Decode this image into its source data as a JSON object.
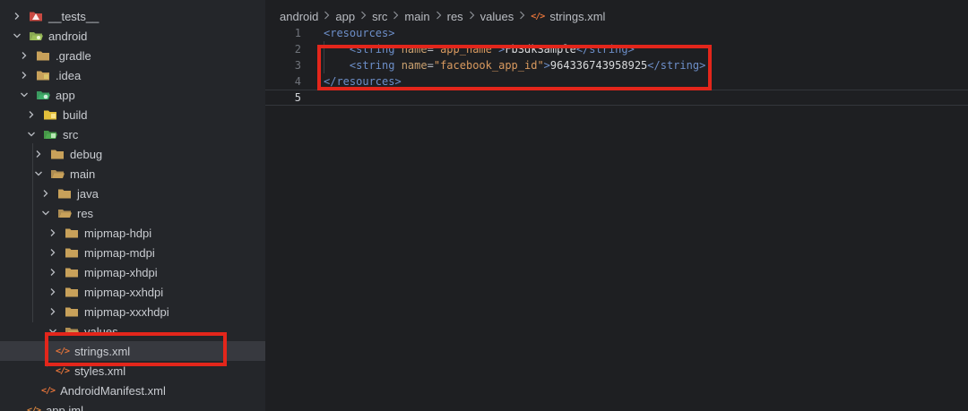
{
  "sidebar": {
    "tree": [
      {
        "label": "__tests__",
        "expanded": false,
        "icon": "tests-folder-icon"
      },
      {
        "label": "android",
        "expanded": true,
        "icon": "android-folder-icon"
      },
      {
        "label": ".gradle",
        "expanded": false,
        "icon": "folder-icon"
      },
      {
        "label": ".idea",
        "expanded": false,
        "icon": "idea-folder-icon"
      },
      {
        "label": "app",
        "expanded": true,
        "icon": "app-folder-icon"
      },
      {
        "label": "build",
        "expanded": false,
        "icon": "build-folder-icon"
      },
      {
        "label": "src",
        "expanded": true,
        "icon": "src-folder-icon"
      },
      {
        "label": "debug",
        "expanded": false,
        "icon": "folder-icon"
      },
      {
        "label": "main",
        "expanded": true,
        "icon": "folder-open-icon"
      },
      {
        "label": "java",
        "expanded": false,
        "icon": "folder-icon"
      },
      {
        "label": "res",
        "expanded": true,
        "icon": "folder-open-icon"
      },
      {
        "label": "mipmap-hdpi",
        "expanded": false,
        "icon": "folder-icon"
      },
      {
        "label": "mipmap-mdpi",
        "expanded": false,
        "icon": "folder-icon"
      },
      {
        "label": "mipmap-xhdpi",
        "expanded": false,
        "icon": "folder-icon"
      },
      {
        "label": "mipmap-xxhdpi",
        "expanded": false,
        "icon": "folder-icon"
      },
      {
        "label": "mipmap-xxxhdpi",
        "expanded": false,
        "icon": "folder-icon"
      },
      {
        "label": "values",
        "expanded": true,
        "icon": "folder-open-icon"
      },
      {
        "label": "strings.xml",
        "selected": true,
        "icon": "xml-file-icon"
      },
      {
        "label": "styles.xml",
        "icon": "xml-file-icon"
      },
      {
        "label": "AndroidManifest.xml",
        "icon": "xml-file-icon"
      },
      {
        "label": "app.iml",
        "icon": "iml-file-icon"
      }
    ]
  },
  "editor": {
    "breadcrumb": [
      "android",
      "app",
      "src",
      "main",
      "res",
      "values",
      "strings.xml"
    ],
    "lines": [
      {
        "no": "1",
        "open": "<resources>"
      },
      {
        "no": "2",
        "indent": "    ",
        "open": "<string",
        "attr": "name",
        "eq": "=",
        "val": "\"app_name\"",
        "close": ">",
        "text": "FbSdkSample",
        "end": "</string>"
      },
      {
        "no": "3",
        "indent": "    ",
        "open": "<string",
        "attr": "name",
        "eq": "=",
        "val": "\"facebook_app_id\"",
        "close": ">",
        "text": "964336743958925",
        "end": "</string>"
      },
      {
        "no": "4",
        "open": "</resources>"
      },
      {
        "no": "5"
      }
    ]
  },
  "colors": {
    "highlight": "#e3261b",
    "xml_icon": "#e3733a",
    "folder": "#c8a15a"
  }
}
